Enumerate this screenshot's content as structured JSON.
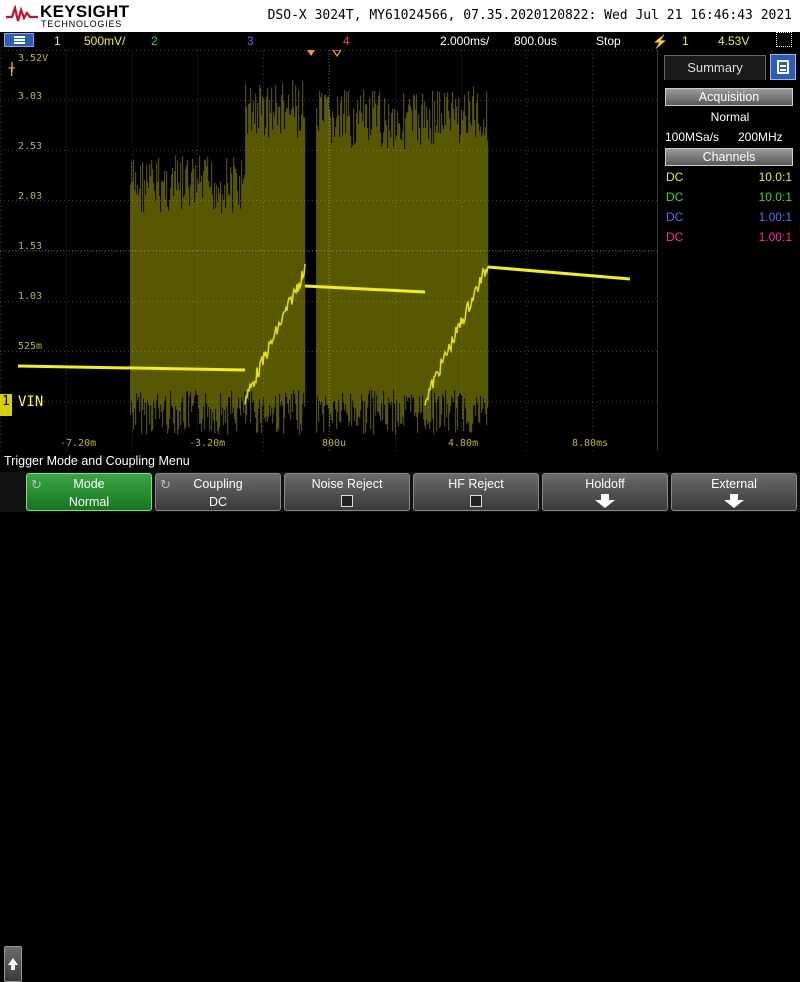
{
  "header": {
    "brand": "KEYSIGHT",
    "brand_sub": "TECHNOLOGIES",
    "scope_title": "DSO-X 3024T, MY61024566, 07.35.2020120822: Wed Jul 21 16:46:43 2021"
  },
  "status": {
    "ch1_num": "1",
    "ch1_scale": "500mV/",
    "ch2_num": "2",
    "ch3_num": "3",
    "ch4_num": "4",
    "timebase": "2.000ms/",
    "delay": "800.0us",
    "run_state": "Stop",
    "trigger_source": "1",
    "trigger_level": "4.53V"
  },
  "plot": {
    "y_labels": [
      "3.52V",
      "3.03",
      "2.53",
      "2.03",
      "1.53",
      "1.03",
      "525m"
    ],
    "x_labels": [
      "-7.20m",
      "-3.20m",
      "800u",
      "4.80m",
      "8.80ms"
    ],
    "ground_label": "1",
    "channel_label": "VIN",
    "trigger_marker": "T"
  },
  "sidebar": {
    "tab_label": "Summary",
    "acquisition_title": "Acquisition",
    "acq_mode": "Normal",
    "sample_rate": "100MSa/s",
    "bandwidth": "200MHz",
    "channels_title": "Channels",
    "channels": [
      {
        "coupling": "DC",
        "probe": "10.0:1",
        "color": "#f2f20a"
      },
      {
        "coupling": "DC",
        "probe": "10.0:1",
        "color": "#28e028"
      },
      {
        "coupling": "DC",
        "probe": "1.00:1",
        "color": "#5a6cff"
      },
      {
        "coupling": "DC",
        "probe": "1.00:1",
        "color": "#ff2aa0"
      }
    ]
  },
  "menu": {
    "title": "Trigger Mode and Coupling Menu",
    "softkeys": [
      {
        "label": "Mode",
        "value": "Normal"
      },
      {
        "label": "Coupling",
        "value": "DC"
      },
      {
        "label": "Noise Reject",
        "value": ""
      },
      {
        "label": "HF Reject",
        "value": ""
      },
      {
        "label": "Holdoff",
        "value": ""
      },
      {
        "label": "External",
        "value": ""
      }
    ]
  },
  "colors": {
    "ch1": "#f2f20a",
    "ch2": "#28e028",
    "ch3": "#5a6cff",
    "ch4": "#ff2aa0",
    "grid": "#3a3a3a"
  }
}
